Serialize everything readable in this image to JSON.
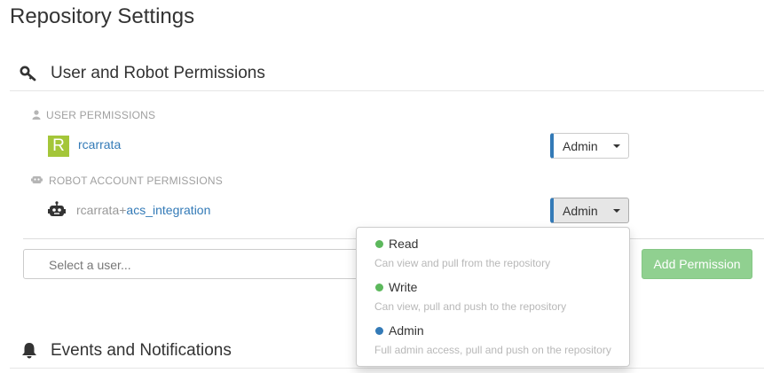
{
  "page": {
    "title": "Repository Settings"
  },
  "permissions": {
    "section_title": "User and Robot Permissions",
    "user_header": "USER PERMISSIONS",
    "robot_header": "ROBOT ACCOUNT PERMISSIONS",
    "user": {
      "avatar_letter": "R",
      "avatar_color": "#a4c639",
      "name": "rcarrata",
      "role": "Admin"
    },
    "robot": {
      "prefix": "rcarrata+",
      "shortname": "acs_integration",
      "role": "Admin"
    },
    "select_user_placeholder": "Select a user...",
    "add_button_label": "Add Permission",
    "add_button_color": "#90d090"
  },
  "role_dropdown": {
    "options": [
      {
        "title": "Read",
        "description": "Can view and pull from the repository",
        "color": "#5cb85c"
      },
      {
        "title": "Write",
        "description": "Can view, pull and push to the repository",
        "color": "#5cb85c"
      },
      {
        "title": "Admin",
        "description": "Full admin access, pull and push on the repository",
        "color": "#337ab7"
      }
    ]
  },
  "events": {
    "section_title": "Events and Notifications"
  },
  "colors": {
    "link": "#337ab7",
    "role_accent": "#337ab7"
  },
  "icons": {
    "permissions": "key-icon",
    "user_header": "user-icon",
    "robot_header": "robot-icon",
    "robot_avatar": "robot-icon",
    "events": "bell-icon"
  }
}
